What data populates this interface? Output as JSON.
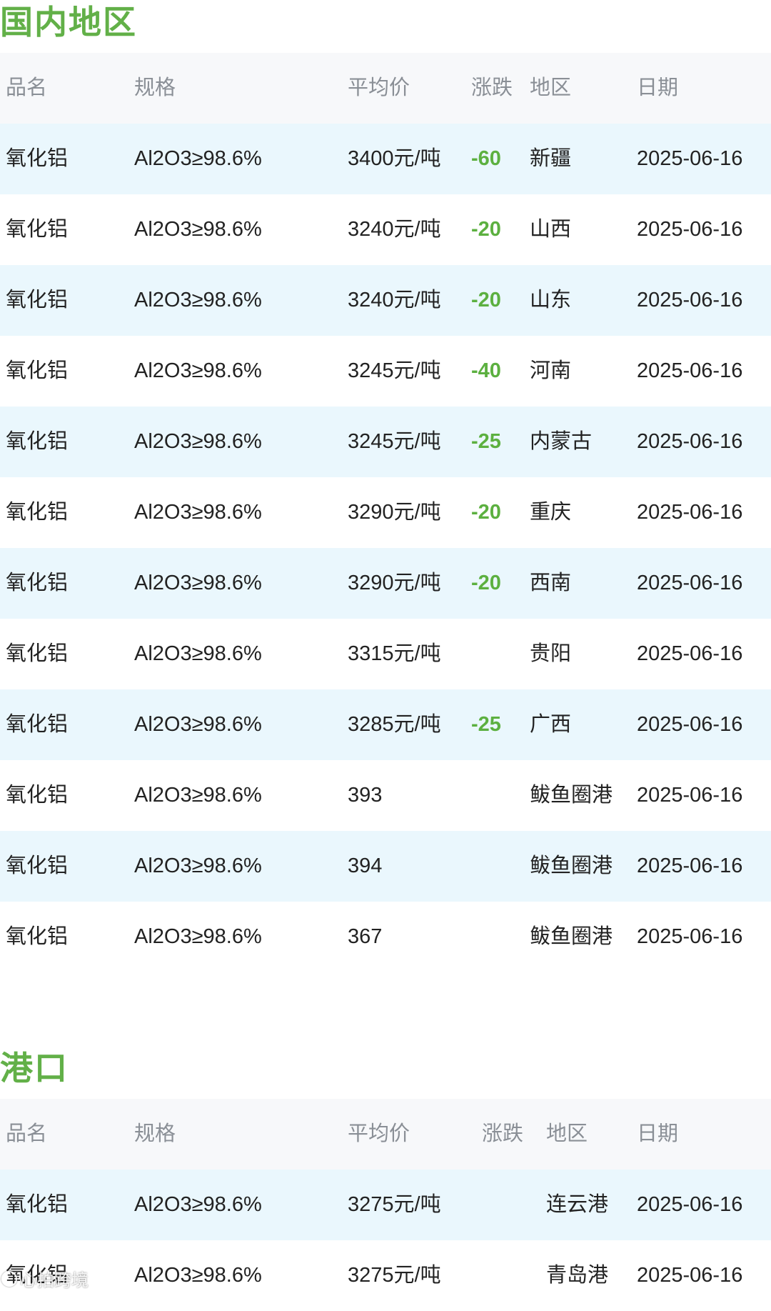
{
  "domestic": {
    "title": "国内地区",
    "headers": {
      "name": "品名",
      "spec": "规格",
      "price": "平均价",
      "change": "涨跌",
      "region": "地区",
      "date": "日期"
    },
    "rows": [
      {
        "name": "氧化铝",
        "spec": "Al2O3≥98.6%",
        "price": "3400元/吨",
        "change": "-60",
        "region": "新疆",
        "date": "2025-06-16"
      },
      {
        "name": "氧化铝",
        "spec": "Al2O3≥98.6%",
        "price": "3240元/吨",
        "change": "-20",
        "region": "山西",
        "date": "2025-06-16"
      },
      {
        "name": "氧化铝",
        "spec": "Al2O3≥98.6%",
        "price": "3240元/吨",
        "change": "-20",
        "region": "山东",
        "date": "2025-06-16"
      },
      {
        "name": "氧化铝",
        "spec": "Al2O3≥98.6%",
        "price": "3245元/吨",
        "change": "-40",
        "region": "河南",
        "date": "2025-06-16"
      },
      {
        "name": "氧化铝",
        "spec": "Al2O3≥98.6%",
        "price": "3245元/吨",
        "change": "-25",
        "region": "内蒙古",
        "date": "2025-06-16"
      },
      {
        "name": "氧化铝",
        "spec": "Al2O3≥98.6%",
        "price": "3290元/吨",
        "change": "-20",
        "region": "重庆",
        "date": "2025-06-16"
      },
      {
        "name": "氧化铝",
        "spec": "Al2O3≥98.6%",
        "price": "3290元/吨",
        "change": "-20",
        "region": "西南",
        "date": "2025-06-16"
      },
      {
        "name": "氧化铝",
        "spec": "Al2O3≥98.6%",
        "price": "3315元/吨",
        "change": "",
        "region": "贵阳",
        "date": "2025-06-16"
      },
      {
        "name": "氧化铝",
        "spec": "Al2O3≥98.6%",
        "price": "3285元/吨",
        "change": "-25",
        "region": "广西",
        "date": "2025-06-16"
      },
      {
        "name": "氧化铝",
        "spec": "Al2O3≥98.6%",
        "price": "393",
        "change": "",
        "region": "鲅鱼圈港",
        "date": "2025-06-16"
      },
      {
        "name": "氧化铝",
        "spec": "Al2O3≥98.6%",
        "price": "394",
        "change": "",
        "region": "鲅鱼圈港",
        "date": "2025-06-16"
      },
      {
        "name": "氧化铝",
        "spec": "Al2O3≥98.6%",
        "price": "367",
        "change": "",
        "region": "鲅鱼圈港",
        "date": "2025-06-16"
      }
    ]
  },
  "port": {
    "title": "港口",
    "headers": {
      "name": "品名",
      "spec": "规格",
      "price": "平均价",
      "change": "涨跌",
      "region": "地区",
      "date": "日期"
    },
    "rows": [
      {
        "name": "氧化铝",
        "spec": "Al2O3≥98.6%",
        "price": "3275元/吨",
        "change": "",
        "region": "连云港",
        "date": "2025-06-16"
      },
      {
        "name": "氧化铝",
        "spec": "Al2O3≥98.6%",
        "price": "3275元/吨",
        "change": "",
        "region": "青岛港",
        "date": "2025-06-16"
      }
    ]
  },
  "watermark": {
    "icon": "weibo-logo-icon",
    "text": "心拍跨境"
  },
  "colors": {
    "accent_green": "#62b048",
    "row_alt": "#eaf7fd",
    "header_bg": "#f7f8fa"
  }
}
